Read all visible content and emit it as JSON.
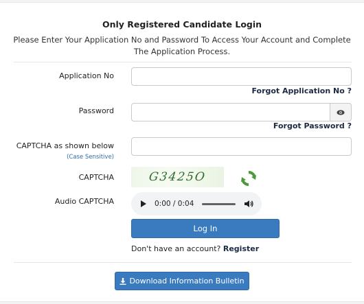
{
  "form": {
    "title": "Only Registered Candidate Login",
    "subtitle": "Please Enter Your Application No and Password To Access Your Account and Complete The Application Process."
  },
  "fields": {
    "application_no": {
      "label": "Application No",
      "value": ""
    },
    "forgot_app_link": "Forgot Application No ?",
    "password": {
      "label": "Password",
      "value": "",
      "toggle_icon": "eye-icon"
    },
    "forgot_pwd_link": "Forgot Password ?",
    "captcha_input": {
      "label": "CAPTCHA as shown below",
      "sublabel": "(Case Sensitive)",
      "value": ""
    },
    "captcha": {
      "label": "CAPTCHA",
      "text": "G3425O",
      "refresh_icon": "refresh-icon"
    },
    "audio_captcha": {
      "label": "Audio CAPTCHA",
      "time": "0:00 / 0:04"
    }
  },
  "actions": {
    "login_label": "Log In",
    "account_prompt": "Don't have an account?",
    "register_label": "Register",
    "download_label": "Download Information Bulletin",
    "download_icon": "download-icon"
  },
  "colors": {
    "primary": "#3a7bc0",
    "link": "#1d2a44",
    "case_note": "#2b6cb0",
    "captcha_green": "#2e6b2e"
  }
}
